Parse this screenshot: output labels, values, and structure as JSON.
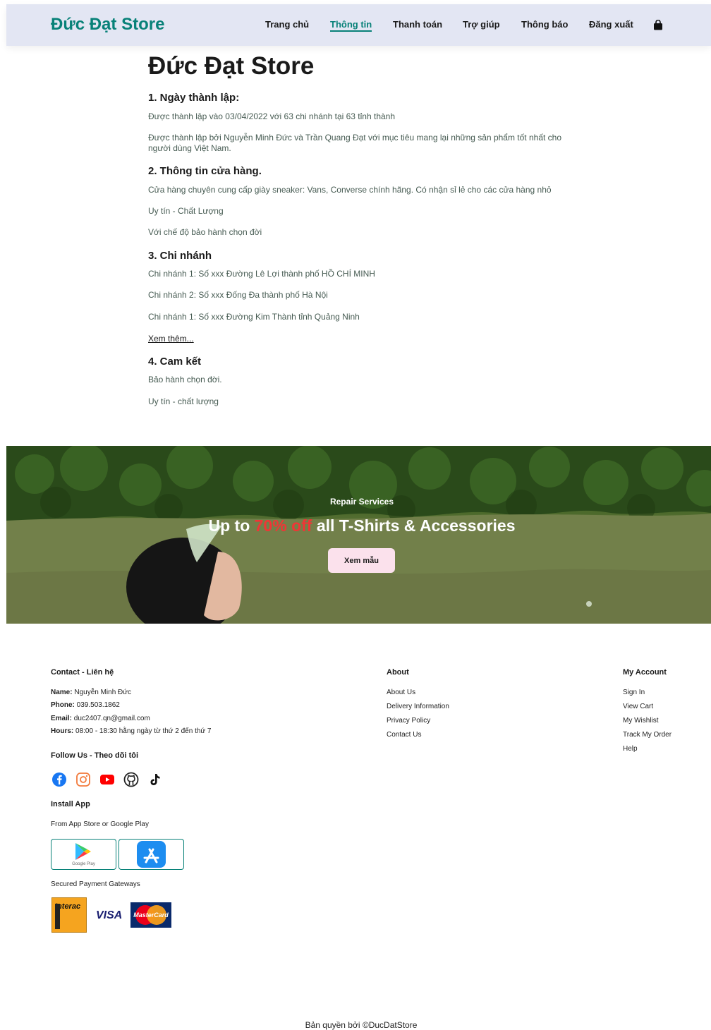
{
  "header": {
    "logo": "Đức Đạt Store",
    "nav": [
      {
        "label": "Trang chủ",
        "active": false
      },
      {
        "label": "Thông tin",
        "active": true
      },
      {
        "label": "Thanh toán",
        "active": false
      },
      {
        "label": "Trợ giúp",
        "active": false
      },
      {
        "label": "Thông báo",
        "active": false
      },
      {
        "label": "Đăng xuất",
        "active": false
      }
    ],
    "cart_icon": "shopping-bag-icon"
  },
  "main": {
    "title": "Đức Đạt Store",
    "sections": [
      {
        "heading": "1. Ngày thành lập:",
        "paragraphs": [
          "Được thành lập vào 03/04/2022 với 63 chi nhánh tại 63 tỉnh thành",
          "Được thành lập bởi Nguyễn Minh Đức và Trần Quang Đạt với mục tiêu mang lại những sản phẩm tốt nhất cho người dùng Việt Nam."
        ]
      },
      {
        "heading": "2. Thông tin cửa hàng.",
        "paragraphs": [
          "Cửa hàng chuyên cung cấp giày sneaker: Vans, Converse chính hãng. Có nhận sỉ lẻ cho các cửa hàng nhỏ",
          "Uy tín - Chất Lượng",
          "Với chế độ bảo hành chọn đời"
        ]
      },
      {
        "heading": "3. Chi nhánh",
        "paragraphs": [
          "Chi nhánh 1: Số xxx Đường Lê Lợi thành phố HỒ CHÍ MINH",
          "Chi nhánh 2: Số xxx Đống Đa thành phố Hà Nội",
          "Chi nhánh 1: Số xxx Đường Kim Thành tỉnh Quảng Ninh"
        ],
        "more_link": "Xem thêm..."
      },
      {
        "heading": "4. Cam kết",
        "paragraphs": [
          "Bảo hành chọn đời.",
          "Uy tín - chất lượng"
        ]
      }
    ]
  },
  "banner": {
    "subtitle": "Repair Services",
    "headline_pre": "Up to ",
    "headline_highlight": "70% off",
    "headline_post": " all T-Shirts & Accessories",
    "button": "Xem mẫu",
    "highlight_color": "#ef3636"
  },
  "footer": {
    "contact": {
      "heading": "Contact - Liên hệ",
      "lines": [
        {
          "label": "Name:",
          "value": "Nguyễn Minh Đức"
        },
        {
          "label": "Phone:",
          "value": "039.503.1862"
        },
        {
          "label": "Email:",
          "value": "duc2407.qn@gmail.com"
        },
        {
          "label": "Hours:",
          "value": "08:00 - 18:30 hằng ngày từ thứ 2 đến thứ 7"
        }
      ]
    },
    "follow": {
      "heading": "Follow Us - Theo dõi tôi",
      "icons": [
        "facebook-icon",
        "instagram-icon",
        "youtube-icon",
        "github-icon",
        "tiktok-icon"
      ]
    },
    "install": {
      "heading": "Install App",
      "text": "From App Store or Google Play",
      "google_play_caption": "Google Play"
    },
    "payment": {
      "text": "Secured Payment Gateways",
      "interac": "Interac",
      "visa": "VISA",
      "mastercard": "MasterCard"
    },
    "about": {
      "heading": "About",
      "links": [
        "About Us",
        "Delivery Information",
        "Privacy Policy",
        "Contact Us"
      ]
    },
    "account": {
      "heading": "My Account",
      "links": [
        "Sign In",
        "View Cart",
        "My Wishlist",
        "Track My Order",
        "Help"
      ]
    },
    "copyright": "Bản quyền bởi ©DucDatStore"
  },
  "colors": {
    "brand": "#088178",
    "header_bg": "#e3e6f3",
    "button_bg": "#fbe1ec"
  }
}
